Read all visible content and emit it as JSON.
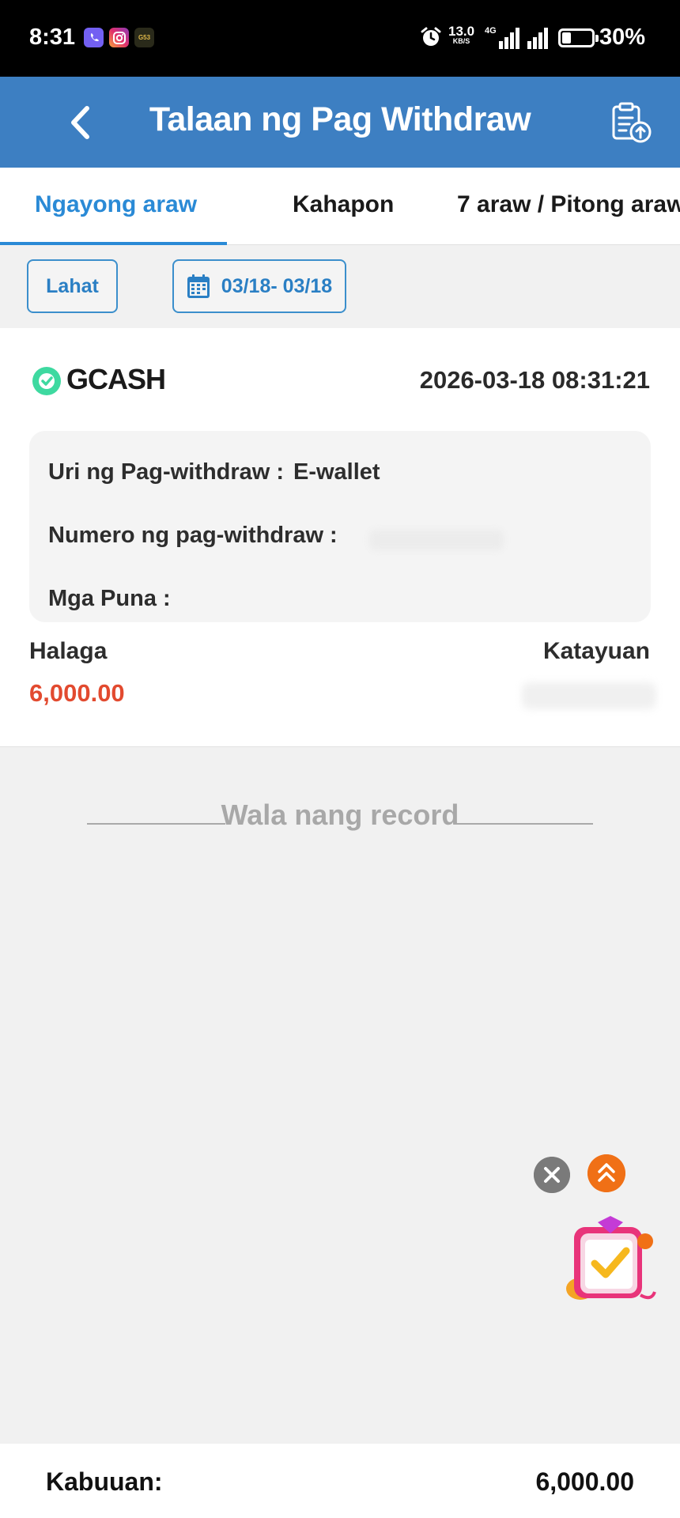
{
  "status_bar": {
    "time": "8:31",
    "apps": [
      "viber-icon",
      "instagram-icon",
      "g53-app-icon"
    ],
    "net_speed": "13.0",
    "net_speed_unit": "KB/S",
    "network": "4G",
    "battery": "30%",
    "battery_level": 0.3
  },
  "header": {
    "title": "Talaan ng Pag Withdraw",
    "back_icon": "chevron-left-icon",
    "action_icon": "clipboard-upload-icon",
    "background": "#3d7fc2"
  },
  "tabs": [
    {
      "label": "Ngayong araw",
      "active": true
    },
    {
      "label": "Kahapon",
      "active": false
    },
    {
      "label": "7 araw / Pitong araw",
      "active": false
    }
  ],
  "filters": {
    "all_label": "Lahat",
    "date_range": "03/18- 03/18"
  },
  "record": {
    "method": "GCASH",
    "datetime": "2026-03-18 08:31:21",
    "type_label": "Uri ng Pag-withdraw :",
    "type_value": "E-wallet",
    "number_label": "Numero ng pag-withdraw :",
    "remarks_label": "Mga Puna :",
    "amount_label": "Halaga",
    "amount": "6,000.00",
    "status_label": "Katayuan",
    "amount_color": "#e24a2f"
  },
  "no_more_text": "Wala nang record",
  "footer": {
    "total_label": "Kabuuan:",
    "total_value": "6,000.00"
  },
  "accent_color": "#2a8ad6"
}
